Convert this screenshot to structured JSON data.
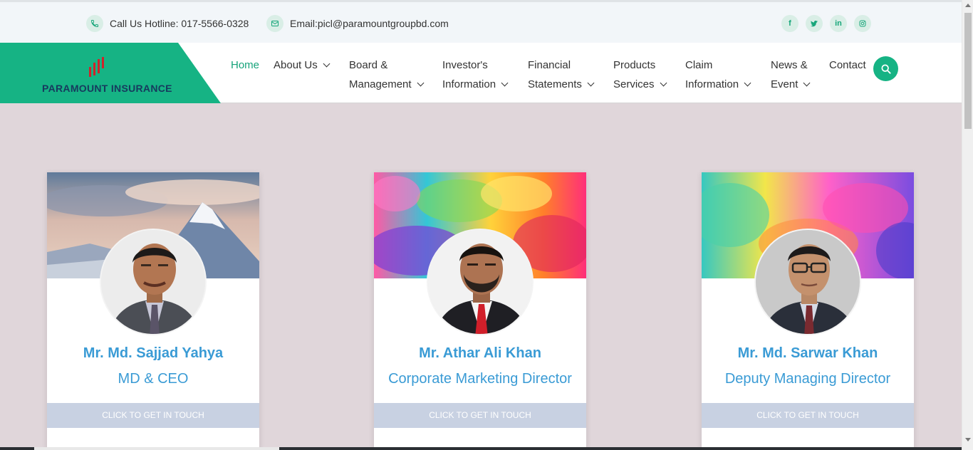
{
  "topbar": {
    "hotline": "Call Us Hotline: 017-5566-0328",
    "email": "Email:picl@paramountgroupbd.com",
    "socials": [
      {
        "icon": "facebook-icon",
        "glyph": "f"
      },
      {
        "icon": "twitter-icon",
        "glyph": "t"
      },
      {
        "icon": "linkedin-icon",
        "glyph": "in"
      },
      {
        "icon": "instagram-icon",
        "glyph": "ig"
      }
    ]
  },
  "brand": {
    "name": "PARAMOUNT INSURANCE",
    "primary_color": "#16b384",
    "logo_color": "#d0232a"
  },
  "nav": {
    "home": "Home",
    "about": "About Us",
    "board_line1": "Board &",
    "board_line2": "Management",
    "investor_line1": "Investor's",
    "investor_line2": "Information",
    "financial_line1": "Financial",
    "financial_line2": "Statements",
    "products_line1": "Products",
    "products_line2": "Services",
    "claim_line1": "Claim",
    "claim_line2": "Information",
    "news_line1": "News &",
    "news_line2": "Event",
    "contact": "Contact"
  },
  "cards": [
    {
      "name": "Mr. Md. Sajjad Yahya",
      "role": "MD & CEO",
      "button": "CLICK TO GET IN TOUCH"
    },
    {
      "name": "Mr. Athar Ali Khan",
      "role": "Corporate Marketing Director",
      "button": "CLICK TO GET IN TOUCH"
    },
    {
      "name": "Mr. Md. Sarwar Khan",
      "role": "Deputy Managing Director",
      "button": "CLICK TO GET IN TOUCH"
    }
  ]
}
